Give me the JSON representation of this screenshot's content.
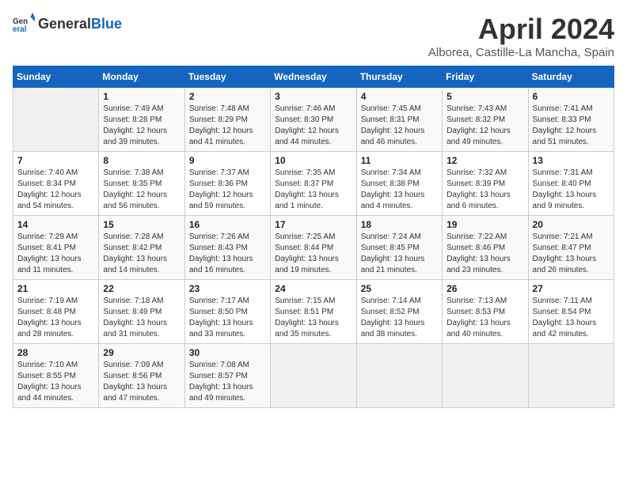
{
  "header": {
    "logo_general": "General",
    "logo_blue": "Blue",
    "month_title": "April 2024",
    "location": "Alborea, Castille-La Mancha, Spain"
  },
  "days_of_week": [
    "Sunday",
    "Monday",
    "Tuesday",
    "Wednesday",
    "Thursday",
    "Friday",
    "Saturday"
  ],
  "weeks": [
    [
      {
        "day": "",
        "info": ""
      },
      {
        "day": "1",
        "info": "Sunrise: 7:49 AM\nSunset: 8:28 PM\nDaylight: 12 hours\nand 39 minutes."
      },
      {
        "day": "2",
        "info": "Sunrise: 7:48 AM\nSunset: 8:29 PM\nDaylight: 12 hours\nand 41 minutes."
      },
      {
        "day": "3",
        "info": "Sunrise: 7:46 AM\nSunset: 8:30 PM\nDaylight: 12 hours\nand 44 minutes."
      },
      {
        "day": "4",
        "info": "Sunrise: 7:45 AM\nSunset: 8:31 PM\nDaylight: 12 hours\nand 46 minutes."
      },
      {
        "day": "5",
        "info": "Sunrise: 7:43 AM\nSunset: 8:32 PM\nDaylight: 12 hours\nand 49 minutes."
      },
      {
        "day": "6",
        "info": "Sunrise: 7:41 AM\nSunset: 8:33 PM\nDaylight: 12 hours\nand 51 minutes."
      }
    ],
    [
      {
        "day": "7",
        "info": "Sunrise: 7:40 AM\nSunset: 8:34 PM\nDaylight: 12 hours\nand 54 minutes."
      },
      {
        "day": "8",
        "info": "Sunrise: 7:38 AM\nSunset: 8:35 PM\nDaylight: 12 hours\nand 56 minutes."
      },
      {
        "day": "9",
        "info": "Sunrise: 7:37 AM\nSunset: 8:36 PM\nDaylight: 12 hours\nand 59 minutes."
      },
      {
        "day": "10",
        "info": "Sunrise: 7:35 AM\nSunset: 8:37 PM\nDaylight: 13 hours\nand 1 minute."
      },
      {
        "day": "11",
        "info": "Sunrise: 7:34 AM\nSunset: 8:38 PM\nDaylight: 13 hours\nand 4 minutes."
      },
      {
        "day": "12",
        "info": "Sunrise: 7:32 AM\nSunset: 8:39 PM\nDaylight: 13 hours\nand 6 minutes."
      },
      {
        "day": "13",
        "info": "Sunrise: 7:31 AM\nSunset: 8:40 PM\nDaylight: 13 hours\nand 9 minutes."
      }
    ],
    [
      {
        "day": "14",
        "info": "Sunrise: 7:29 AM\nSunset: 8:41 PM\nDaylight: 13 hours\nand 11 minutes."
      },
      {
        "day": "15",
        "info": "Sunrise: 7:28 AM\nSunset: 8:42 PM\nDaylight: 13 hours\nand 14 minutes."
      },
      {
        "day": "16",
        "info": "Sunrise: 7:26 AM\nSunset: 8:43 PM\nDaylight: 13 hours\nand 16 minutes."
      },
      {
        "day": "17",
        "info": "Sunrise: 7:25 AM\nSunset: 8:44 PM\nDaylight: 13 hours\nand 19 minutes."
      },
      {
        "day": "18",
        "info": "Sunrise: 7:24 AM\nSunset: 8:45 PM\nDaylight: 13 hours\nand 21 minutes."
      },
      {
        "day": "19",
        "info": "Sunrise: 7:22 AM\nSunset: 8:46 PM\nDaylight: 13 hours\nand 23 minutes."
      },
      {
        "day": "20",
        "info": "Sunrise: 7:21 AM\nSunset: 8:47 PM\nDaylight: 13 hours\nand 26 minutes."
      }
    ],
    [
      {
        "day": "21",
        "info": "Sunrise: 7:19 AM\nSunset: 8:48 PM\nDaylight: 13 hours\nand 28 minutes."
      },
      {
        "day": "22",
        "info": "Sunrise: 7:18 AM\nSunset: 8:49 PM\nDaylight: 13 hours\nand 31 minutes."
      },
      {
        "day": "23",
        "info": "Sunrise: 7:17 AM\nSunset: 8:50 PM\nDaylight: 13 hours\nand 33 minutes."
      },
      {
        "day": "24",
        "info": "Sunrise: 7:15 AM\nSunset: 8:51 PM\nDaylight: 13 hours\nand 35 minutes."
      },
      {
        "day": "25",
        "info": "Sunrise: 7:14 AM\nSunset: 8:52 PM\nDaylight: 13 hours\nand 38 minutes."
      },
      {
        "day": "26",
        "info": "Sunrise: 7:13 AM\nSunset: 8:53 PM\nDaylight: 13 hours\nand 40 minutes."
      },
      {
        "day": "27",
        "info": "Sunrise: 7:11 AM\nSunset: 8:54 PM\nDaylight: 13 hours\nand 42 minutes."
      }
    ],
    [
      {
        "day": "28",
        "info": "Sunrise: 7:10 AM\nSunset: 8:55 PM\nDaylight: 13 hours\nand 44 minutes."
      },
      {
        "day": "29",
        "info": "Sunrise: 7:09 AM\nSunset: 8:56 PM\nDaylight: 13 hours\nand 47 minutes."
      },
      {
        "day": "30",
        "info": "Sunrise: 7:08 AM\nSunset: 8:57 PM\nDaylight: 13 hours\nand 49 minutes."
      },
      {
        "day": "",
        "info": ""
      },
      {
        "day": "",
        "info": ""
      },
      {
        "day": "",
        "info": ""
      },
      {
        "day": "",
        "info": ""
      }
    ]
  ]
}
